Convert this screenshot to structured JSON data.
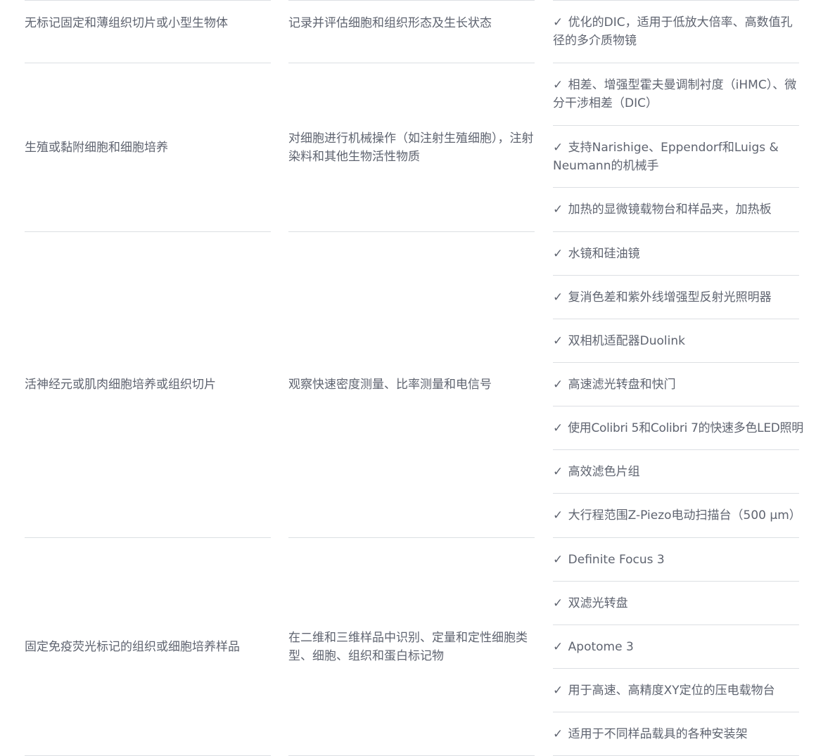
{
  "rows": [
    {
      "sample": "无标记固定和薄组织切片或小型生物体",
      "task": "记录并评估细胞和组织形态及生长状态",
      "features": [
        "优化的DIC，适用于低放大倍率、高数值孔径的多介质物镜"
      ]
    },
    {
      "sample": "生殖或黏附细胞和细胞培养",
      "task": "对细胞进行机械操作（如注射生殖细胞），注射染料和其他生物活性物质",
      "features": [
        "相差、增强型霍夫曼调制衬度（iHMC）、微分干涉相差（DIC）",
        "支持Narishige、Eppendorf和Luigs & Neumann的机械手",
        "加热的显微镜载物台和样品夹，加热板"
      ]
    },
    {
      "sample": "活神经元或肌肉细胞培养或组织切片",
      "task": "观察快速密度测量、比率测量和电信号",
      "features": [
        "水镜和硅油镜",
        "复消色差和紫外线增强型反射光照明器",
        "双相机适配器Duolink",
        "高速滤光转盘和快门",
        "使用Colibri 5和Colibri 7的快速多色LED照明",
        "高效滤色片组",
        "大行程范围Z-Piezo电动扫描台（500 µm）"
      ]
    },
    {
      "sample": "固定免疫荧光标记的组织或细胞培养样品",
      "task": "在二维和三维样品中识别、定量和定性细胞类型、细胞、组织和蛋白标记物",
      "features": [
        "Definite Focus 3",
        "双滤光转盘",
        "Apotome 3",
        "用于高速、高精度XY定位的压电载物台",
        "适用于不同样品载具的各种安装架"
      ]
    }
  ],
  "check_mark": "✓",
  "colors": {
    "text": "#5f6470",
    "divider": "#dcdfe3",
    "background": "#ffffff"
  }
}
